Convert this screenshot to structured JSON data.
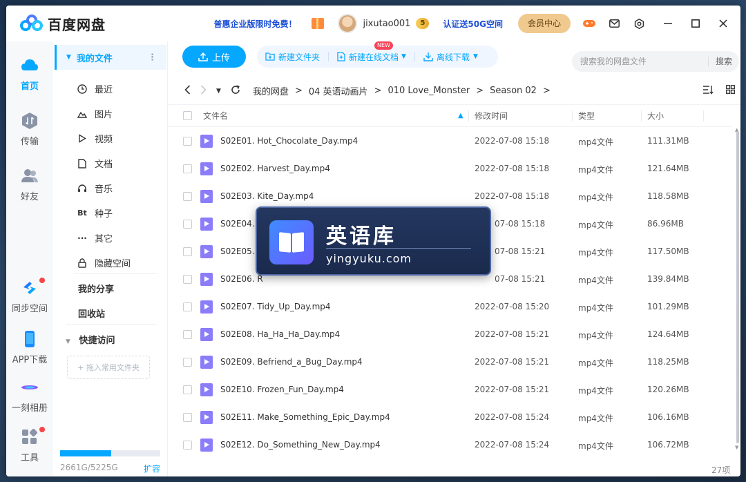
{
  "titlebar": {
    "app_name": "百度网盘",
    "promo": "普惠企业版限时免费！",
    "username": "jixutao001",
    "vip_level": "5",
    "certify": "认证送50G空间",
    "member_center": "会员中心"
  },
  "rail": {
    "items": [
      {
        "label": "首页"
      },
      {
        "label": "传输"
      },
      {
        "label": "好友"
      },
      {
        "label": "同步空间"
      },
      {
        "label": "APP下载"
      },
      {
        "label": "一刻相册"
      },
      {
        "label": "工具"
      }
    ]
  },
  "nav": {
    "my_files": "我的文件",
    "sub_items": [
      {
        "label": "最近",
        "icon": "clock-icon"
      },
      {
        "label": "图片",
        "icon": "image-icon"
      },
      {
        "label": "视频",
        "icon": "video-icon"
      },
      {
        "label": "文档",
        "icon": "document-icon"
      },
      {
        "label": "音乐",
        "icon": "headphones-icon"
      },
      {
        "label": "种子",
        "icon": "bt-icon"
      },
      {
        "label": "其它",
        "icon": "more-icon"
      },
      {
        "label": "隐藏空间",
        "icon": "lock-icon"
      }
    ],
    "my_share": "我的分享",
    "recycle": "回收站",
    "quick_access": "快捷访问",
    "drag_hint": "+ 拖入常用文件夹",
    "quota_text": "2661G/5225G",
    "quota_used_fraction": 0.509,
    "expand": "扩容"
  },
  "toolbar": {
    "upload": "上传",
    "new_folder": "新建文件夹",
    "new_online_doc": "新建在线文档",
    "new_badge": "NEW",
    "offline_download": "离线下载",
    "search_placeholder": "搜索我的网盘文件",
    "search_button": "搜索"
  },
  "breadcrumb": [
    "我的网盘",
    "04 英语动画片",
    "010 Love_Monster",
    "Season 02"
  ],
  "table": {
    "headers": {
      "name": "文件名",
      "time": "修改时间",
      "type": "类型",
      "size": "大小"
    },
    "rows": [
      {
        "name": "S02E01. Hot_Chocolate_Day.mp4",
        "time": "2022-07-08 15:18",
        "type": "mp4文件",
        "size": "111.31MB"
      },
      {
        "name": "S02E02. Harvest_Day.mp4",
        "time": "2022-07-08 15:18",
        "type": "mp4文件",
        "size": "121.64MB"
      },
      {
        "name": "S02E03. Kite_Day.mp4",
        "time": "2022-07-08 15:18",
        "type": "mp4文件",
        "size": "118.58MB"
      },
      {
        "name": "S02E04. Sl",
        "time": "07-08 15:18",
        "type": "mp4文件",
        "size": "86.96MB"
      },
      {
        "name": "S02E05. Fl",
        "time": "07-08 15:21",
        "type": "mp4文件",
        "size": "117.50MB"
      },
      {
        "name": "S02E06. R",
        "time": "07-08 15:21",
        "type": "mp4文件",
        "size": "139.84MB"
      },
      {
        "name": "S02E07. Tidy_Up_Day.mp4",
        "time": "2022-07-08 15:20",
        "type": "mp4文件",
        "size": "101.29MB"
      },
      {
        "name": "S02E08. Ha_Ha_Ha_Day.mp4",
        "time": "2022-07-08 15:21",
        "type": "mp4文件",
        "size": "124.64MB"
      },
      {
        "name": "S02E09. Befriend_a_Bug_Day.mp4",
        "time": "2022-07-08 15:21",
        "type": "mp4文件",
        "size": "118.25MB"
      },
      {
        "name": "S02E10. Frozen_Fun_Day.mp4",
        "time": "2022-07-08 15:21",
        "type": "mp4文件",
        "size": "120.26MB"
      },
      {
        "name": "S02E11. Make_Something_Epic_Day.mp4",
        "time": "2022-07-08 15:24",
        "type": "mp4文件",
        "size": "106.16MB"
      },
      {
        "name": "S02E12. Do_Something_New_Day.mp4",
        "time": "2022-07-08 15:24",
        "type": "mp4文件",
        "size": "106.72MB"
      }
    ]
  },
  "item_count": "27项",
  "watermark": {
    "title": "英语库",
    "url": "yingyuku.com"
  },
  "colors": {
    "accent": "#06a7ff",
    "promo": "#1c4fd6",
    "file_icon": "#8b7dfa",
    "badge": "#f5455a"
  }
}
